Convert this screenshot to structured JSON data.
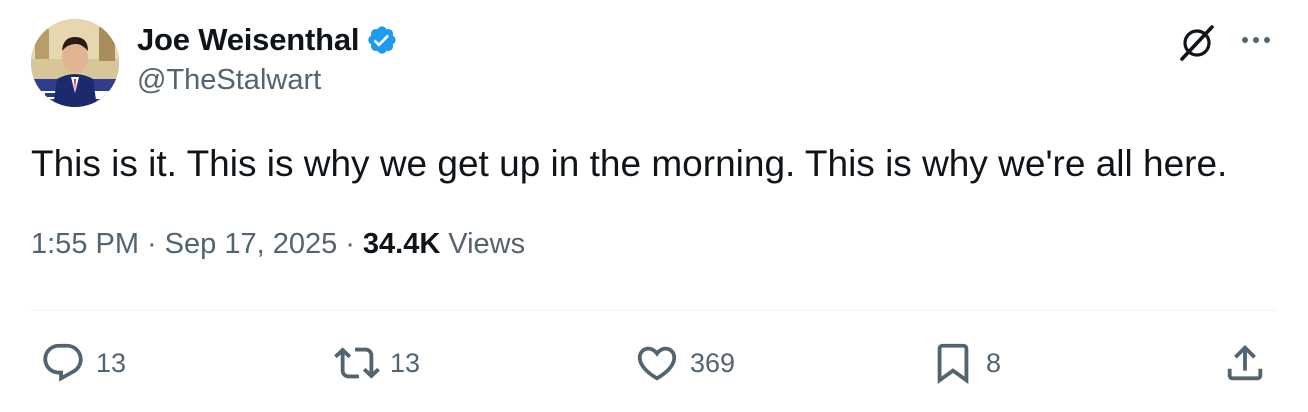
{
  "author": {
    "display_name": "Joe Weisenthal",
    "handle": "@TheStalwart",
    "verified": true,
    "avatar_icon": "avatar-photo"
  },
  "tweet": {
    "text": "This is it. This is why we get up in the morning. This is why we're all here."
  },
  "meta": {
    "time": "1:55 PM",
    "separator": "·",
    "date": "Sep 17, 2025",
    "views_count": "34.4K",
    "views_label": "Views"
  },
  "actions": {
    "replies": "13",
    "reposts": "13",
    "likes": "369",
    "bookmarks": "8"
  },
  "icons": {
    "verified": "verified-badge-icon",
    "grok": "grok-icon",
    "more": "more-icon",
    "reply": "reply-icon",
    "repost": "repost-icon",
    "like": "heart-icon",
    "bookmark": "bookmark-icon",
    "share": "share-icon"
  },
  "colors": {
    "text_primary": "#0f1419",
    "text_secondary": "#536471",
    "verified_blue": "#1d9bf0",
    "divider": "#eff3f4"
  }
}
